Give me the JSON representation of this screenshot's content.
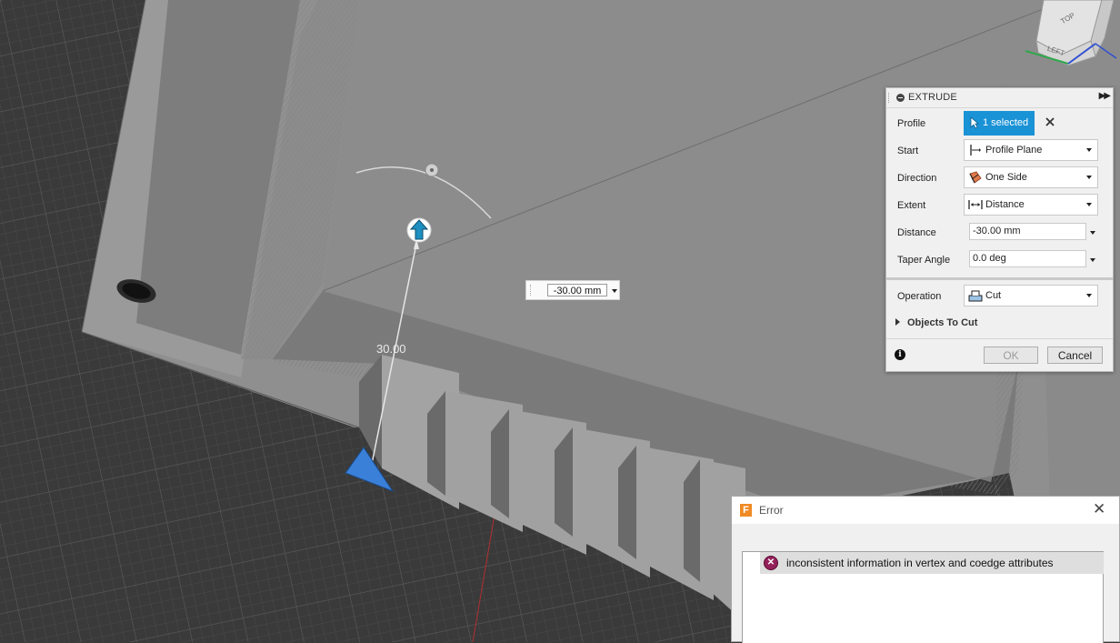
{
  "viewport": {
    "dimension_input_value": "-30.00 mm",
    "dimension_label": "30.00",
    "view_cube": {
      "top_label": "TOP",
      "left_label": "LEFT"
    }
  },
  "extrude_panel": {
    "title": "EXTRUDE",
    "profile": {
      "label": "Profile",
      "selection": "1 selected"
    },
    "start": {
      "label": "Start",
      "value": "Profile Plane"
    },
    "direction": {
      "label": "Direction",
      "value": "One Side"
    },
    "extent": {
      "label": "Extent",
      "value": "Distance"
    },
    "distance": {
      "label": "Distance",
      "value": "-30.00 mm"
    },
    "taper_angle": {
      "label": "Taper Angle",
      "value": "0.0 deg"
    },
    "operation": {
      "label": "Operation",
      "value": "Cut"
    },
    "objects_to_cut": "Objects To Cut",
    "ok_label": "OK",
    "cancel_label": "Cancel"
  },
  "error_dialog": {
    "title": "Error",
    "logo_letter": "F",
    "message": "inconsistent information in vertex and coedge attributes"
  },
  "colors": {
    "accent_blue": "#1a92d6",
    "error_icon": "#94205a",
    "grid_background": "#3a3a3a",
    "model_gray": "#8e8e8e"
  }
}
